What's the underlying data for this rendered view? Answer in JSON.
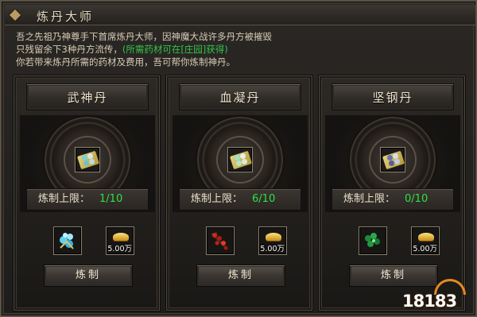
{
  "window": {
    "title": "炼丹大师"
  },
  "description": {
    "line1": "吾之先祖乃神尊手下首席炼丹大师，因神魔大战许多丹方被摧毁",
    "line2_prefix": "只残留余下3种丹方流传，",
    "line2_highlight": "(所需药材可在[庄园]获得)",
    "line3": "你若带来炼丹所需的药材及费用，吾可帮你炼制神丹。"
  },
  "cards": [
    {
      "name": "武神丹",
      "item_icon": "wushen-pill-icon",
      "pill_colors": [
        "#7ad1d6",
        "#d6e6ea",
        "#6fc3c8",
        "#c1d9dc"
      ],
      "limit_label": "炼制上限：",
      "limit_value": "1/10",
      "material_icon": "blue-crystal-herb-icon",
      "cost": "5.00万",
      "button": "炼制"
    },
    {
      "name": "血凝丹",
      "item_icon": "xuening-pill-icon",
      "pill_colors": [
        "#9fe1c4",
        "#e6efe8",
        "#b7e3cf",
        "#d9e9e1"
      ],
      "limit_label": "炼制上限：",
      "limit_value": "6/10",
      "material_icon": "red-berry-herb-icon",
      "cost": "5.00万",
      "button": "炼制"
    },
    {
      "name": "坚钢丹",
      "item_icon": "jiangang-pill-icon",
      "pill_colors": [
        "#6b6fae",
        "#d9dde6",
        "#585d9a",
        "#c5c9d8"
      ],
      "limit_label": "炼制上限：",
      "limit_value": "0/10",
      "material_icon": "green-leaf-herb-icon",
      "cost": "5.00万",
      "button": "炼制"
    }
  ],
  "colors": {
    "highlight_green": "#34c34a",
    "limit_green": "#2fe046",
    "text": "#d8ccb5"
  },
  "watermark": "18183"
}
